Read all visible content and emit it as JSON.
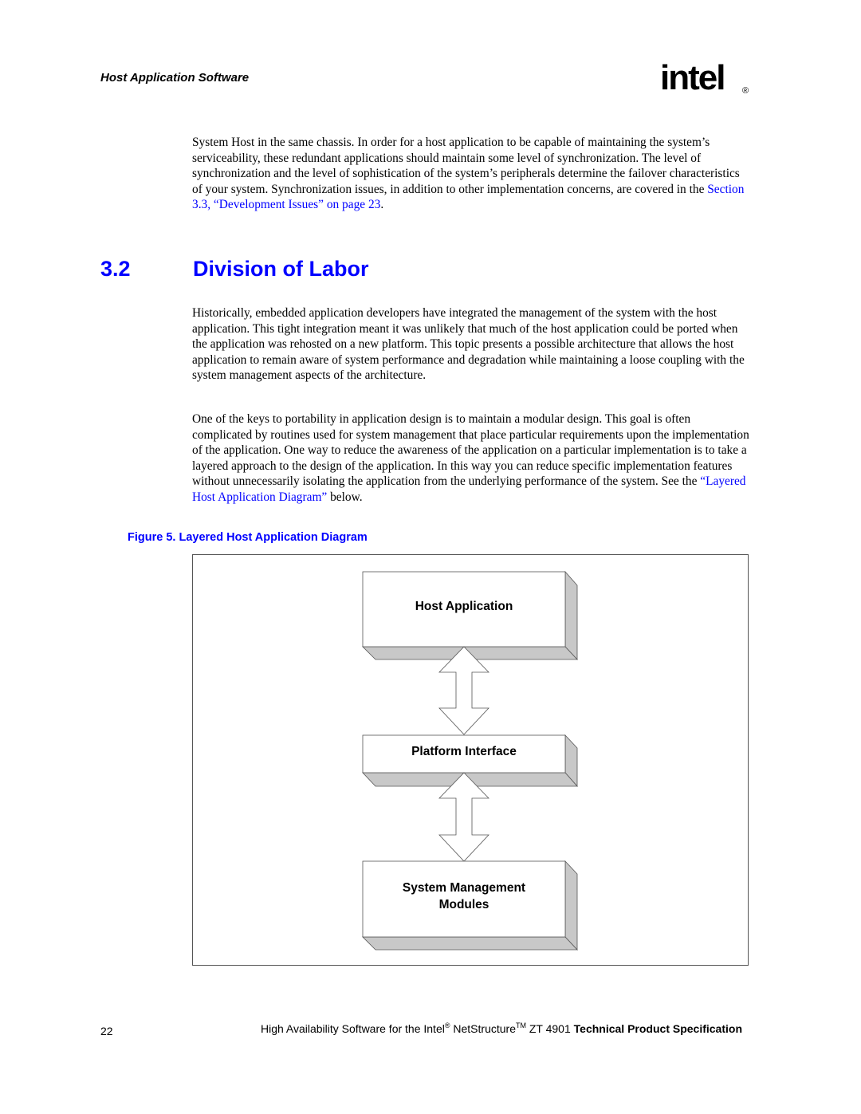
{
  "header": {
    "running_title": "Host Application Software",
    "logo_text": "intel",
    "logo_mark": "®"
  },
  "paragraphs": {
    "p1_text": "System Host in the same chassis. In order for a host application to be capable of maintaining the system’s serviceability, these redundant applications should maintain some level of synchronization. The level of synchronization and the level of sophistication of the system’s peripherals determine the failover characteristics of your system. Synchronization issues, in addition to other implementation concerns, are covered in the ",
    "p1_link": "Section 3.3, “Development Issues” on page 23",
    "p1_end": ".",
    "p2_text": "Historically, embedded application developers have integrated the management of the system with the host application. This tight integration meant it was unlikely that much of the host application could be ported when the application was rehosted on a new platform. This topic presents a possible architecture that allows the host application to remain aware of system performance and degradation while maintaining a loose coupling with the system management aspects of the architecture.",
    "p3_text": "One of the keys to portability in application design is to maintain a modular design. This goal is often complicated by routines used for system management that place particular requirements upon the implementation of the application. One way to reduce the awareness of the application on a particular implementation is to take a layered approach to the design of the application. In this way you can reduce specific implementation features without unnecessarily isolating the application from the underlying performance of the system. See the ",
    "p3_link": "“Layered Host Application Diagram”",
    "p3_end": " below."
  },
  "section": {
    "number": "3.2",
    "title": "Division of Labor"
  },
  "figure": {
    "caption": "Figure 5.  Layered Host Application Diagram",
    "boxes": [
      {
        "line1": "Host Application"
      },
      {
        "line1": "Platform Interface"
      },
      {
        "line1": "System Management",
        "line2": "Modules"
      }
    ]
  },
  "footer": {
    "page_number": "22",
    "text_a": "High Availability Software for the Intel",
    "sup_a": "®",
    "text_b": " NetStructure",
    "sup_b": "TM",
    "text_c": " ZT 4901 ",
    "text_bold": "Technical Product Specification"
  },
  "colors": {
    "link": "#0000ff",
    "heading": "#0000ff",
    "box_shade": "#c8c8c8"
  }
}
